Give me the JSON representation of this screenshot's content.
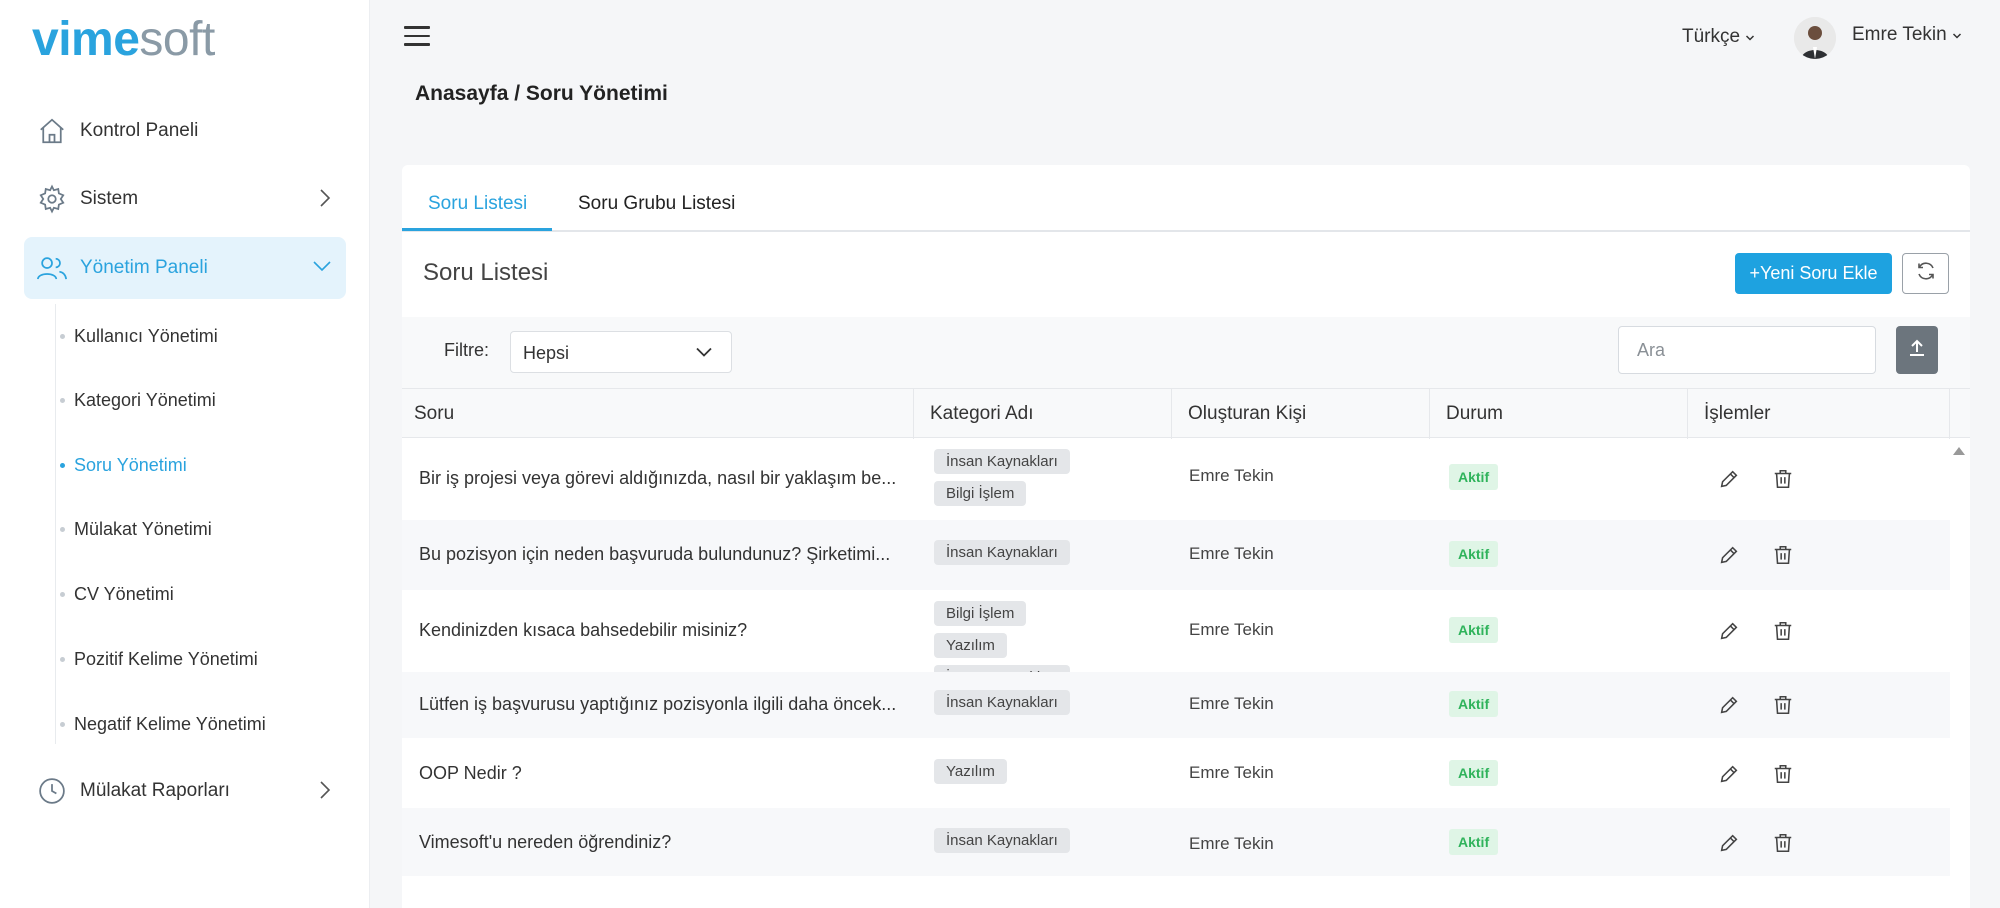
{
  "brand": {
    "part1": "vime",
    "part2": "soft"
  },
  "sidebar": {
    "items": [
      {
        "label": "Kontrol Paneli",
        "icon": "home-icon"
      },
      {
        "label": "Sistem",
        "icon": "gear-icon"
      },
      {
        "label": "Yönetim Paneli",
        "icon": "users-icon"
      },
      {
        "label": "Mülakat Raporları",
        "icon": "clock-icon"
      }
    ],
    "subitems": [
      "Kullanıcı Yönetimi",
      "Kategori Yönetimi",
      "Soru Yönetimi",
      "Mülakat Yönetimi",
      "CV Yönetimi",
      "Pozitif Kelime Yönetimi",
      "Negatif Kelime Yönetimi"
    ]
  },
  "header": {
    "language": "Türkçe",
    "user_name": "Emre Tekin",
    "breadcrumb": "Anasayfa / Soru Yönetimi"
  },
  "tabs": [
    "Soru Listesi",
    "Soru Grubu Listesi"
  ],
  "card": {
    "title": "Soru Listesi",
    "add_button": "+Yeni Soru Ekle"
  },
  "filter": {
    "label": "Filtre:",
    "selected": "Hepsi",
    "search_placeholder": "Ara"
  },
  "table": {
    "columns": [
      "Soru",
      "Kategori Adı",
      "Oluşturan Kişi",
      "Durum",
      "İşlemler"
    ],
    "rows": [
      {
        "question": "Bir iş projesi veya görevi aldığınızda, nasıl bir yaklaşım be...",
        "categories": [
          "İnsan Kaynakları",
          "Bilgi İşlem"
        ],
        "author": "Emre Tekin",
        "status": "Aktif"
      },
      {
        "question": "Bu pozisyon için neden başvuruda bulundunuz? Şirketimi...",
        "categories": [
          "İnsan Kaynakları"
        ],
        "author": "Emre Tekin",
        "status": "Aktif"
      },
      {
        "question": "Kendinizden kısaca bahsedebilir misiniz?",
        "categories": [
          "Bilgi İşlem",
          "Yazılım",
          "İnsan Kaynakları"
        ],
        "author": "Emre Tekin",
        "status": "Aktif"
      },
      {
        "question": "Lütfen iş başvurusu yaptığınız pozisyonla ilgili daha öncek...",
        "categories": [
          "İnsan Kaynakları"
        ],
        "author": "Emre Tekin",
        "status": "Aktif"
      },
      {
        "question": "OOP Nedir ?",
        "categories": [
          "Yazılım"
        ],
        "author": "Emre Tekin",
        "status": "Aktif"
      },
      {
        "question": "Vimesoft'u nereden öğrendiniz?",
        "categories": [
          "İnsan Kaynakları"
        ],
        "author": "Emre Tekin",
        "status": "Aktif"
      }
    ]
  },
  "colors": {
    "accent": "#2aa3de",
    "button": "#1ea2e0",
    "status_bg": "#dff5e6",
    "status_text": "#2fb35b"
  }
}
